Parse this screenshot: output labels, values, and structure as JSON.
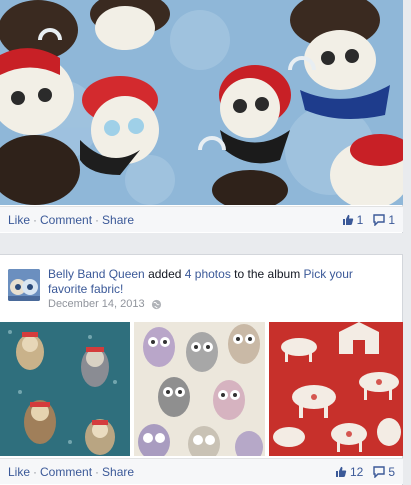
{
  "post1": {
    "actions": {
      "like": "Like",
      "comment": "Comment",
      "share": "Share",
      "sep": "·",
      "like_count": "1",
      "comment_count": "1"
    }
  },
  "post2": {
    "author": "Belly Band Queen",
    "verb_text": " added ",
    "photos_link": "4 photos",
    "album_text": " to the album ",
    "album_name": "Pick your favorite fabric!",
    "date": "December 14, 2013",
    "actions": {
      "like": "Like",
      "comment": "Comment",
      "share": "Share",
      "sep": "·",
      "like_count": "12",
      "comment_count": "5"
    }
  },
  "icons": {
    "like": "thumbs-up-icon",
    "comment": "speech-bubble-icon",
    "privacy": "globe-icon"
  },
  "colors": {
    "link": "#3b5998",
    "muted": "#90949c",
    "background": "#e9ebee"
  }
}
